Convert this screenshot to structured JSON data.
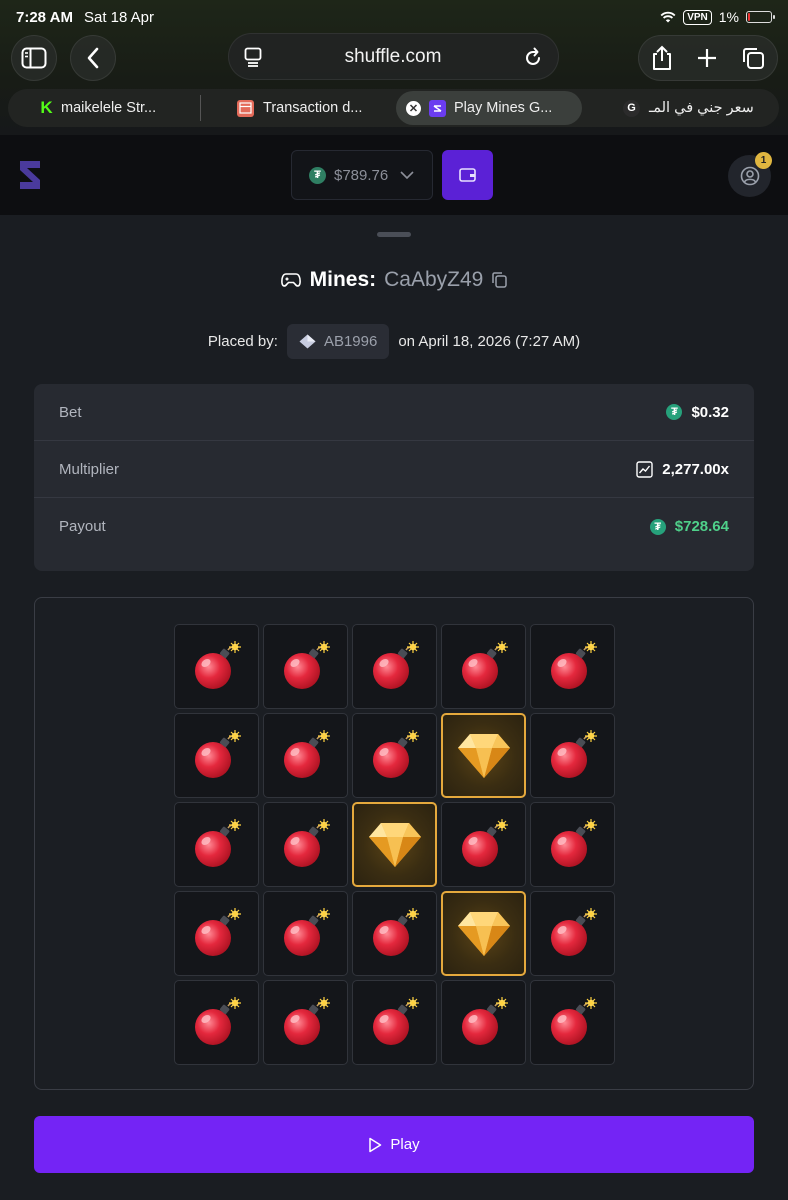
{
  "status_bar": {
    "time": "7:28 AM",
    "date": "Sat 18 Apr",
    "vpn": "VPN",
    "battery_percent": "1%",
    "battery_level": 0.01
  },
  "browser": {
    "url": "shuffle.com",
    "tabs": [
      {
        "label": "maikelele Str...",
        "icon": "K",
        "icon_color": "#53fc18"
      },
      {
        "label": "Transaction d...",
        "icon": "box-icon",
        "icon_color": "#e46b5a"
      },
      {
        "label": "Play Mines G...",
        "icon": "shuffle-logo",
        "icon_color": "#6b3cf0",
        "active": true
      },
      {
        "label": "سعر جني في المـ",
        "icon": "G",
        "icon_color": "#2b2b2b"
      }
    ]
  },
  "site_header": {
    "balance": "$789.76",
    "notification_count": "1",
    "accent": "#5b21d6"
  },
  "game": {
    "title_label": "Mines:",
    "game_id": "CaAbyZ49",
    "placed_by_label": "Placed by:",
    "username": "AB1996",
    "placed_on": "on April 18, 2026 (7:27 AM)"
  },
  "details": {
    "bet_label": "Bet",
    "bet_value": "$0.32",
    "multiplier_label": "Multiplier",
    "multiplier_value": "2,277.00x",
    "payout_label": "Payout",
    "payout_value": "$728.64",
    "payout_color": "#4fd08a"
  },
  "board": {
    "rows": 5,
    "cols": 5,
    "tiles": [
      "mine",
      "mine",
      "mine",
      "mine",
      "mine",
      "mine",
      "mine",
      "mine",
      "gem",
      "mine",
      "mine",
      "mine",
      "gem",
      "mine",
      "mine",
      "mine",
      "mine",
      "mine",
      "gem",
      "mine",
      "mine",
      "mine",
      "mine",
      "mine",
      "mine"
    ]
  },
  "play_button": {
    "label": "Play",
    "color": "#7424f5"
  }
}
